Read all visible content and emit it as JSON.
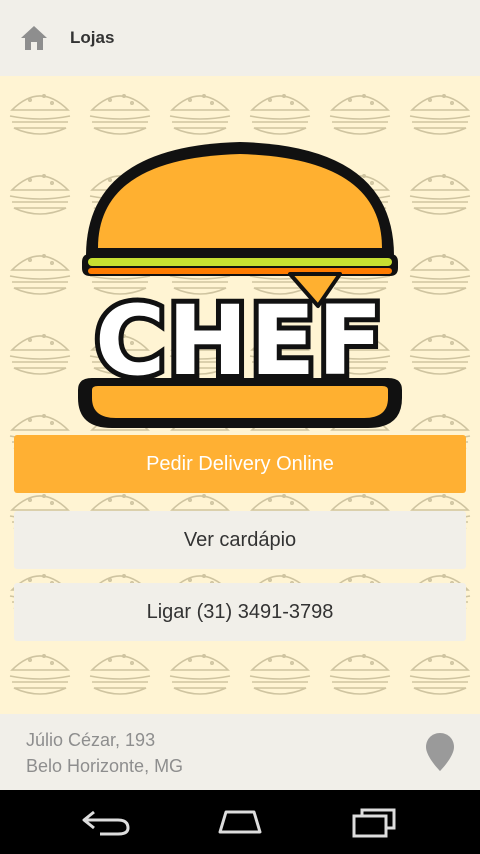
{
  "topbar": {
    "title": "Lojas",
    "icon": "home-icon"
  },
  "logo": {
    "text": "CHEF"
  },
  "buttons": {
    "delivery": "Pedir Delivery Online",
    "menu": "Ver cardápio",
    "call": "Ligar (31) 3491-3798"
  },
  "footer": {
    "address_line1": "Júlio Cézar, 193",
    "address_line2": "Belo Horizonte, MG",
    "icon": "map-pin-icon"
  },
  "colors": {
    "accent": "#ffb033",
    "background": "#fff4d3",
    "bar": "#f1efe9"
  }
}
